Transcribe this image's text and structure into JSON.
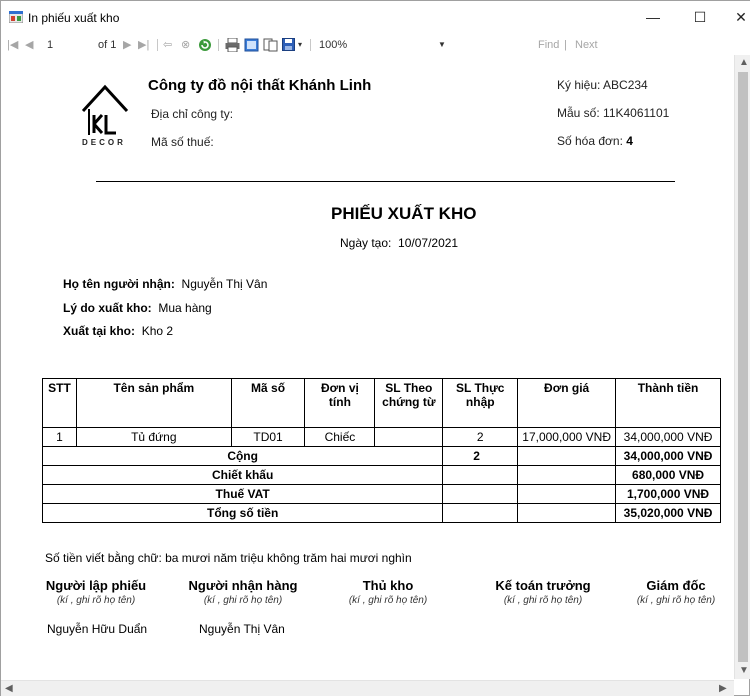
{
  "window": {
    "title": "In phiếu xuất kho",
    "minimize": "—",
    "maximize": "☐",
    "close": "✕"
  },
  "toolbar": {
    "page_current": "1",
    "page_of": "of 1",
    "zoom": "100%",
    "find": "Find",
    "next": "Next"
  },
  "company": {
    "name": "Công ty đồ nội thất Khánh Linh",
    "address_label": "Địa chỉ công ty:",
    "tax_label": "Mã số thuế:",
    "logo_text": "DECOR"
  },
  "invoice_info": {
    "symbol_label": "Ký hiệu:",
    "symbol": "ABC234",
    "form_label": "Mẫu số:",
    "form": "11K4061101",
    "number_label": "Số hóa đơn:",
    "number": "4"
  },
  "document": {
    "title": "PHIẾU XUẤT KHO",
    "date_label": "Ngày tạo:",
    "date": "10/07/2021"
  },
  "recipient": {
    "name_label": "Họ tên người nhận:",
    "name": "Nguyễn Thị Vân",
    "reason_label": "Lý do xuất kho:",
    "reason": "Mua hàng",
    "warehouse_label": "Xuất tại kho:",
    "warehouse": "Kho 2"
  },
  "table": {
    "headers": [
      "STT",
      "Tên sản phẩm",
      "Mã số",
      "Đơn vị tính",
      "SL Theo chứng từ",
      "SL Thực nhập",
      "Đơn giá",
      "Thành tiền"
    ],
    "rows": [
      [
        "1",
        "Tủ đứng",
        "TD01",
        "Chiếc",
        "",
        "2",
        "17,000,000 VNĐ",
        "34,000,000 VNĐ"
      ]
    ],
    "total_label": "Cộng",
    "total_qty": "2",
    "total_amount": "34,000,000 VNĐ",
    "discount_label": "Chiết khấu",
    "discount": "680,000 VNĐ",
    "vat_label": "Thuế VAT",
    "vat": "1,700,000 VNĐ",
    "grand_label": "Tổng số tiền",
    "grand_total": "35,020,000 VNĐ"
  },
  "amount_in_words": "Số tiền viết bằng chữ: ba mươi năm  triệu không trăm hai mươi  nghìn",
  "signatures": [
    {
      "role": "Người lập phiếu",
      "hint": "(kí , ghi rõ họ tên)",
      "name": "Nguyễn Hữu Duẩn"
    },
    {
      "role": "Người nhận hàng",
      "hint": "(kí , ghi rõ họ tên)",
      "name": "Nguyễn Thị Vân"
    },
    {
      "role": "Thủ kho",
      "hint": "(kí , ghi rõ họ tên)",
      "name": ""
    },
    {
      "role": "Kế toán trưởng",
      "hint": "(kí , ghi rõ họ tên)",
      "name": ""
    },
    {
      "role": "Giám đốc",
      "hint": "(kí , ghi rõ họ tên)",
      "name": ""
    }
  ],
  "colors": {
    "accent_blue": "#1e6fd9",
    "separator": "#c8c8c8"
  }
}
